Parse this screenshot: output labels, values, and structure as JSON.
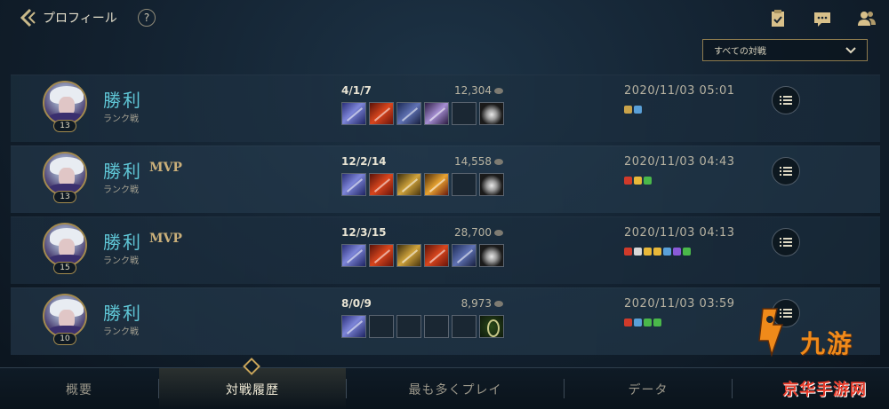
{
  "header": {
    "title": "プロフィール",
    "help_label": "?",
    "icons": [
      "checklist-icon",
      "chat-icon",
      "friends-icon"
    ]
  },
  "filter": {
    "label": "すべての対戦"
  },
  "matches": [
    {
      "result": "勝利",
      "mvp": "",
      "mode": "ランク戦",
      "level": "13",
      "kda": "4/1/7",
      "gold": "12,304",
      "items": [
        "blue",
        "red",
        "bluedark",
        "purple",
        "empty",
        "helm"
      ],
      "date": "2020/11/03 05:01",
      "badges": [
        "#c9a34a",
        "#5aa0d8"
      ]
    },
    {
      "result": "勝利",
      "mvp": "MVP",
      "mode": "ランク戦",
      "level": "13",
      "kda": "12/2/14",
      "gold": "14,558",
      "items": [
        "blue",
        "red",
        "gold-i",
        "goldred",
        "empty",
        "helm"
      ],
      "date": "2020/11/03 04:43",
      "badges": [
        "#d03a2a",
        "#e8b83a",
        "#4ab84a"
      ]
    },
    {
      "result": "勝利",
      "mvp": "MVP",
      "mode": "ランク戦",
      "level": "15",
      "kda": "12/3/15",
      "gold": "28,700",
      "items": [
        "blue",
        "red",
        "gold-i",
        "red",
        "bluedark",
        "helm"
      ],
      "date": "2020/11/03 04:13",
      "badges": [
        "#d03a2a",
        "#d8d8d8",
        "#e8b83a",
        "#e8b83a",
        "#5aa0d8",
        "#8a5ad8",
        "#4ab84a"
      ]
    },
    {
      "result": "勝利",
      "mvp": "",
      "mode": "ランク戦",
      "level": "10",
      "kda": "8/0/9",
      "gold": "8,973",
      "items": [
        "blue",
        "empty",
        "empty",
        "empty",
        "empty",
        "snake"
      ],
      "date": "2020/11/03 03:59",
      "badges": [
        "#d03a2a",
        "#5aa0d8",
        "#4ab84a",
        "#4ab84a"
      ]
    }
  ],
  "tabs": [
    {
      "label": "概要",
      "active": false
    },
    {
      "label": "対戦履歴",
      "active": true
    },
    {
      "label": "最も多くプレイ",
      "active": false
    },
    {
      "label": "データ",
      "active": false
    }
  ],
  "watermarks": {
    "brand": "九游",
    "site": "京华手游网"
  },
  "colors": {
    "result": "#5fc6d6",
    "accent_gold": "#c9a55a",
    "watermark_orange": "#f08a1a",
    "watermark_red": "#e63b2a"
  }
}
